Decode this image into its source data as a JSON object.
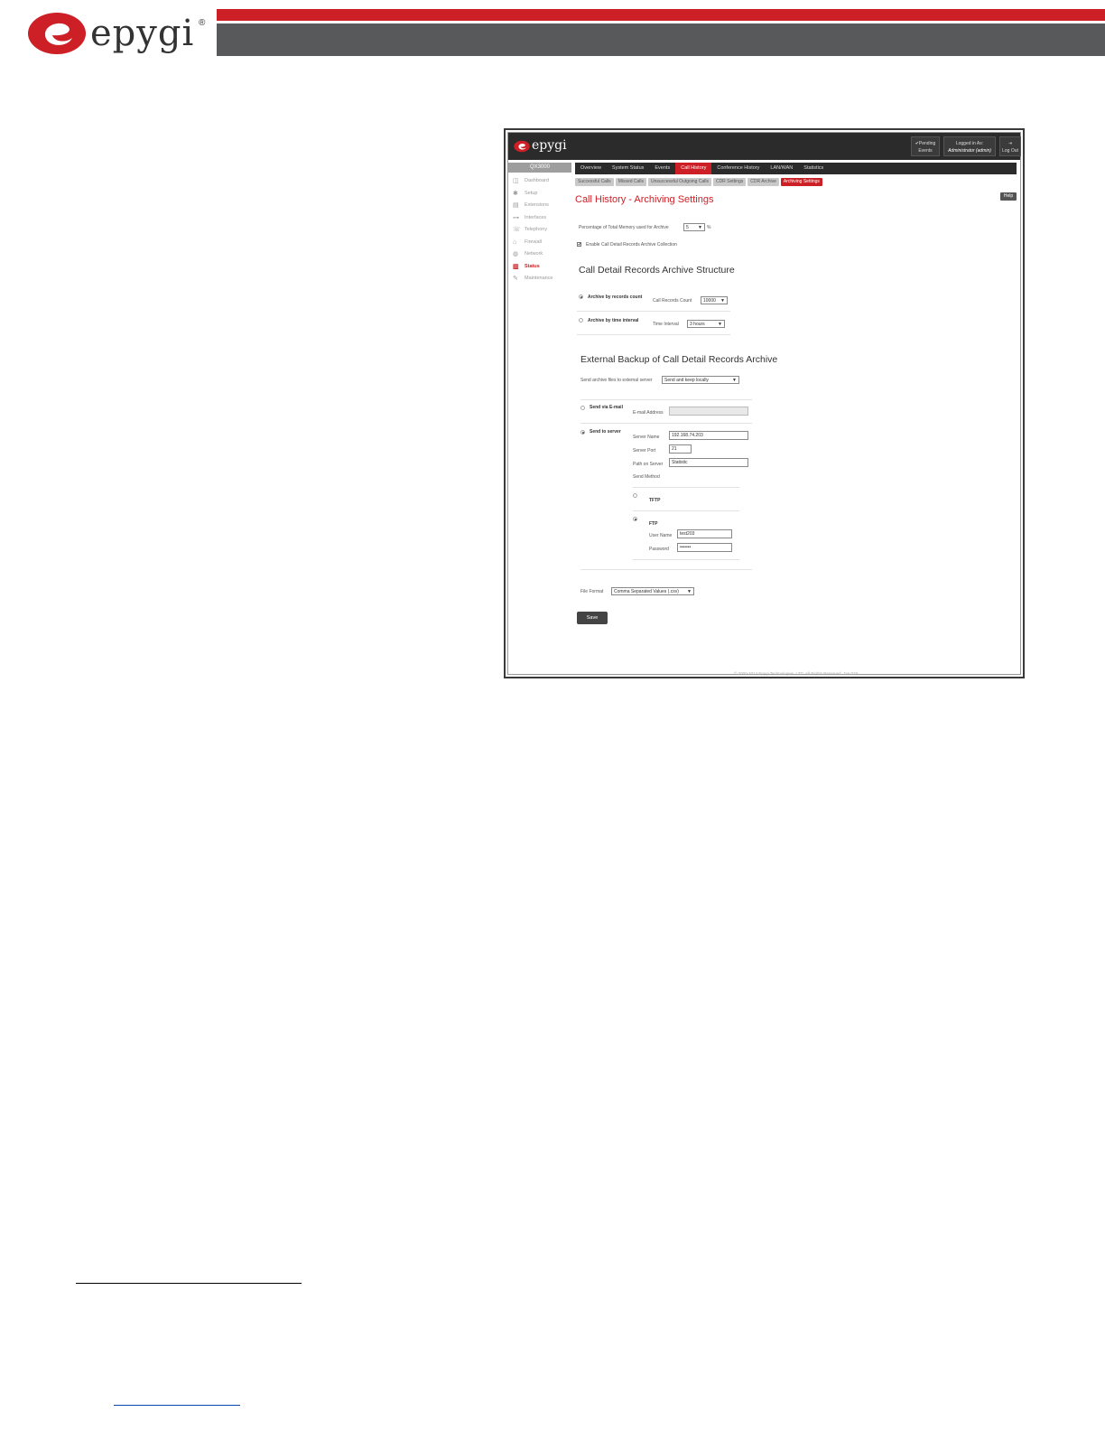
{
  "doc_header": {
    "logo_text": "epygi",
    "logo_reg": "®"
  },
  "app": {
    "logo_text": "epygi",
    "pending": "✔Pending Events",
    "logged_in_label": "Logged in As:",
    "logged_in_user": "Administrator (admin)",
    "logout_label": "Log Out",
    "sidebar_title": "QX3000",
    "sidebar": [
      {
        "label": "Dashboard",
        "icon": "dashboard-icon"
      },
      {
        "label": "Setup",
        "icon": "gear-icon"
      },
      {
        "label": "Extensions",
        "icon": "extensions-icon"
      },
      {
        "label": "Interfaces",
        "icon": "interfaces-icon"
      },
      {
        "label": "Telephony",
        "icon": "phone-icon"
      },
      {
        "label": "Firewall",
        "icon": "firewall-icon"
      },
      {
        "label": "Network",
        "icon": "globe-icon"
      },
      {
        "label": "Status",
        "icon": "chart-icon"
      },
      {
        "label": "Maintenance",
        "icon": "wrench-icon"
      }
    ],
    "tabs": [
      "Overview",
      "System Status",
      "Events",
      "Call History",
      "Conference History",
      "LAN/WAN",
      "Statistics"
    ],
    "subtabs": [
      "Successful Calls",
      "Missed Calls",
      "Unsuccessful Outgoing Calls",
      "CDR Settings",
      "CDR Archive",
      "Archiving Settings"
    ],
    "page_title": "Call History - Archiving Settings",
    "help_label": "Help",
    "memory_label": "Percentage of Total Memory used for Archive",
    "memory_value": "5",
    "memory_unit": "%",
    "enable_label": "Enable Call Detail Records Archive Collection",
    "structure_title": "Call Detail Records Archive Structure",
    "archive_by_count": "Archive by records count",
    "records_count_label": "Call Records Count",
    "records_count_value": "10000",
    "archive_by_time": "Archive by time interval",
    "time_interval_label": "Time Interval",
    "time_interval_value": "3 hours",
    "backup_title": "External Backup of Call Detail Records Archive",
    "send_files_label": "Send archive files to external server",
    "send_files_value": "Send and keep locally",
    "send_email": "Send via E-mail",
    "email_label": "E-mail Address",
    "send_server": "Send to server",
    "server_name_label": "Server Name",
    "server_name_value": "192.168.74.203",
    "server_port_label": "Server Port",
    "server_port_value": "21",
    "path_label": "Path on Server",
    "path_value": "Statistic",
    "send_method_label": "Send Method",
    "tftp": "TFTP",
    "ftp": "FTP",
    "user_label": "User Name",
    "user_value": "test203",
    "password_label": "Password",
    "password_value": "•••••••",
    "file_format_label": "File Format",
    "file_format_value": "Comma Separated Values (.csv)",
    "save_label": "Save",
    "footer": "© 2000-2014 Epygi Technologies, LTD. All Rights Reserved. Jan.019"
  }
}
